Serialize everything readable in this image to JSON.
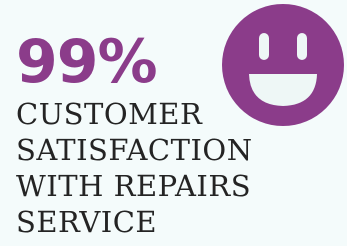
{
  "stat": {
    "value": "99%",
    "caption_lines": [
      "CUSTOMER",
      "SATISFACTION",
      "WITH REPAIRS",
      "SERVICE"
    ]
  },
  "icon": {
    "name": "smiley-face-icon",
    "face_color": "#8b3c8a",
    "feature_color": "#eef7f6"
  },
  "colors": {
    "background": "#f4fbfb",
    "accent": "#8b3c8a",
    "text": "#242424"
  }
}
